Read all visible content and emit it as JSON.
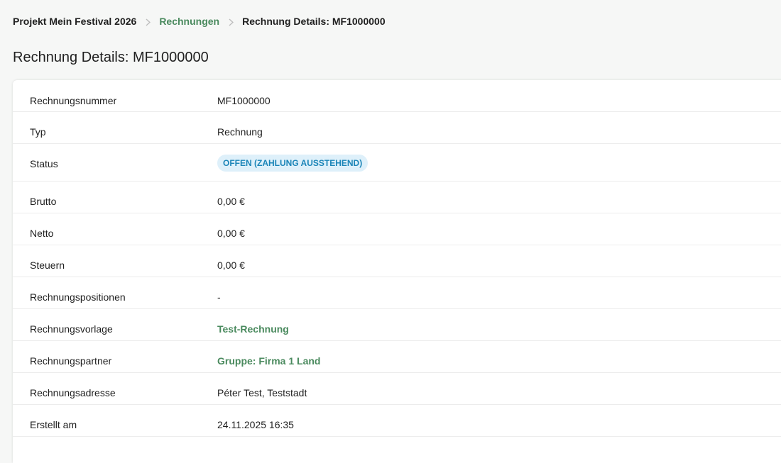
{
  "breadcrumb": {
    "project": "Projekt Mein Festival 2026",
    "section": "Rechnungen",
    "current": "Rechnung Details: MF1000000"
  },
  "page_title": "Rechnung Details: MF1000000",
  "details": {
    "rows": [
      {
        "label": "Rechnungsnummer",
        "value": "MF1000000"
      },
      {
        "label": "Typ",
        "value": "Rechnung"
      },
      {
        "label": "Status",
        "value": "OFFEN (ZAHLUNG AUSSTEHEND)"
      },
      {
        "label": "Brutto",
        "value": "0,00 €"
      },
      {
        "label": "Netto",
        "value": "0,00 €"
      },
      {
        "label": "Steuern",
        "value": "0,00 €"
      },
      {
        "label": "Rechnungspositionen",
        "value": "-"
      },
      {
        "label": "Rechnungsvorlage",
        "value": "Test-Rechnung"
      },
      {
        "label": "Rechnungspartner",
        "value": "Gruppe: Firma 1 Land"
      },
      {
        "label": "Rechnungsadresse",
        "value": "Péter Test, Teststadt"
      },
      {
        "label": "Erstellt am",
        "value": "24.11.2025 16:35"
      }
    ]
  },
  "colors": {
    "link_green": "#4a8a5e",
    "badge_bg": "#def0fa",
    "badge_text": "#1b85b8",
    "page_bg": "#f6f7f6"
  }
}
